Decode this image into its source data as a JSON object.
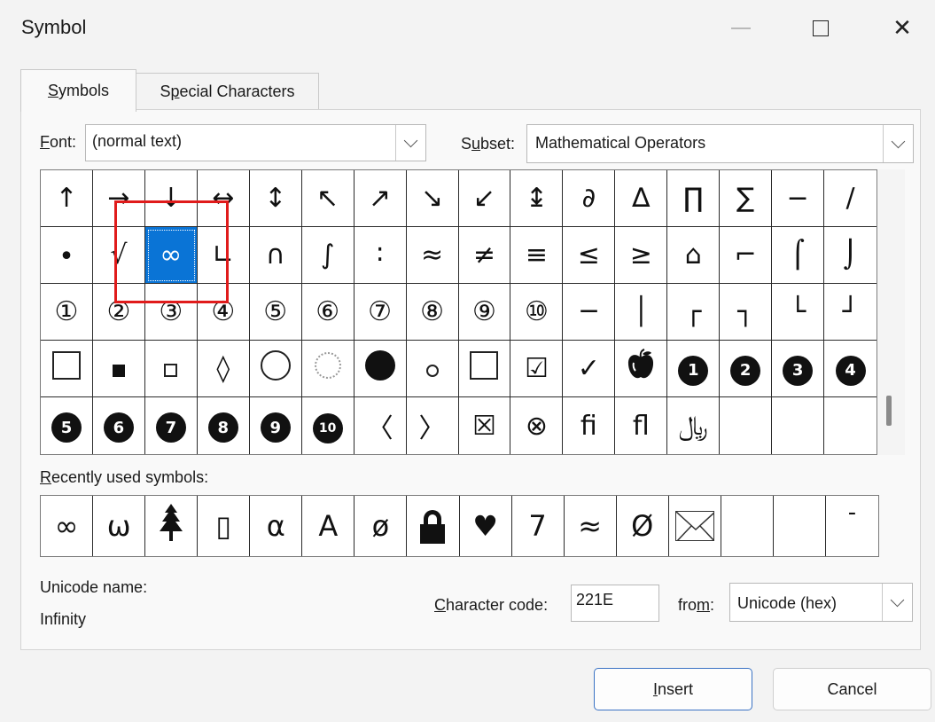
{
  "window": {
    "title": "Symbol",
    "minimize_icon": "minimize-icon",
    "maximize_icon": "maximize-icon",
    "close_icon": "close-icon",
    "close_glyph": "✕"
  },
  "tabs": [
    {
      "label_accel": "S",
      "label_rest": "ymbols",
      "active": true
    },
    {
      "label_pre": "S",
      "label_accel": "p",
      "label_rest": "ecial Characters",
      "active": false
    }
  ],
  "font": {
    "label_accel": "F",
    "label_rest": "ont:",
    "value": "(normal text)"
  },
  "subset": {
    "label_pre": "S",
    "label_accel": "u",
    "label_rest": "bset:",
    "value": "Mathematical Operators"
  },
  "symbol_grid": {
    "rows": [
      [
        "↑",
        "→",
        "↓",
        "↔",
        "↕",
        "↖",
        "↗",
        "↘",
        "↙",
        "↨",
        "∂",
        "∆",
        "∏",
        "∑",
        "−",
        "∕"
      ],
      [
        "∙",
        "√",
        "∞",
        "∟",
        "∩",
        "∫",
        "∶",
        "≈",
        "≠",
        "≡",
        "≤",
        "≥",
        "⌂",
        "⌐",
        "⌠",
        "⌡"
      ],
      [
        "①",
        "②",
        "③",
        "④",
        "⑤",
        "⑥",
        "⑦",
        "⑧",
        "⑨",
        "⑩",
        "─",
        "│",
        "┌",
        "┐",
        "└",
        "┘"
      ],
      [
        "□",
        "■",
        "▫",
        "◊",
        "○",
        "◌",
        "●",
        "◦",
        "☐",
        "☑",
        "✓",
        "apple-icon",
        "❶",
        "❷",
        "❸",
        "❹"
      ],
      [
        "❺",
        "❻",
        "❼",
        "❽",
        "❾",
        "❿",
        "〈",
        "〉",
        "☒",
        "⊗",
        "ﬁ",
        "ﬂ",
        "﷼",
        "",
        "",
        ""
      ]
    ],
    "selected_row": 1,
    "selected_col": 2
  },
  "recent": {
    "label_accel": "R",
    "label_rest": "ecently used symbols:",
    "symbols": [
      "∞",
      "ω",
      "tree-icon",
      "▯",
      "α",
      "A",
      "ø",
      "lock-icon",
      "♥",
      "7",
      "≈",
      "Ø",
      "envelope-icon",
      "",
      "‾",
      "-"
    ]
  },
  "unicode": {
    "name_label": "Unicode name:",
    "name_value": "Infinity"
  },
  "character_code": {
    "label_accel": "C",
    "label_rest": "haracter code:",
    "value": "221E"
  },
  "from": {
    "label_pre": "fro",
    "label_accel": "m",
    "label_rest": ":",
    "value": "Unicode (hex)"
  },
  "buttons": {
    "insert_accel": "I",
    "insert_rest": "nsert",
    "cancel": "Cancel"
  },
  "colors": {
    "selection": "#0a74d6",
    "highlight_box": "#e01b1b",
    "insert_border": "#3a72c4"
  }
}
